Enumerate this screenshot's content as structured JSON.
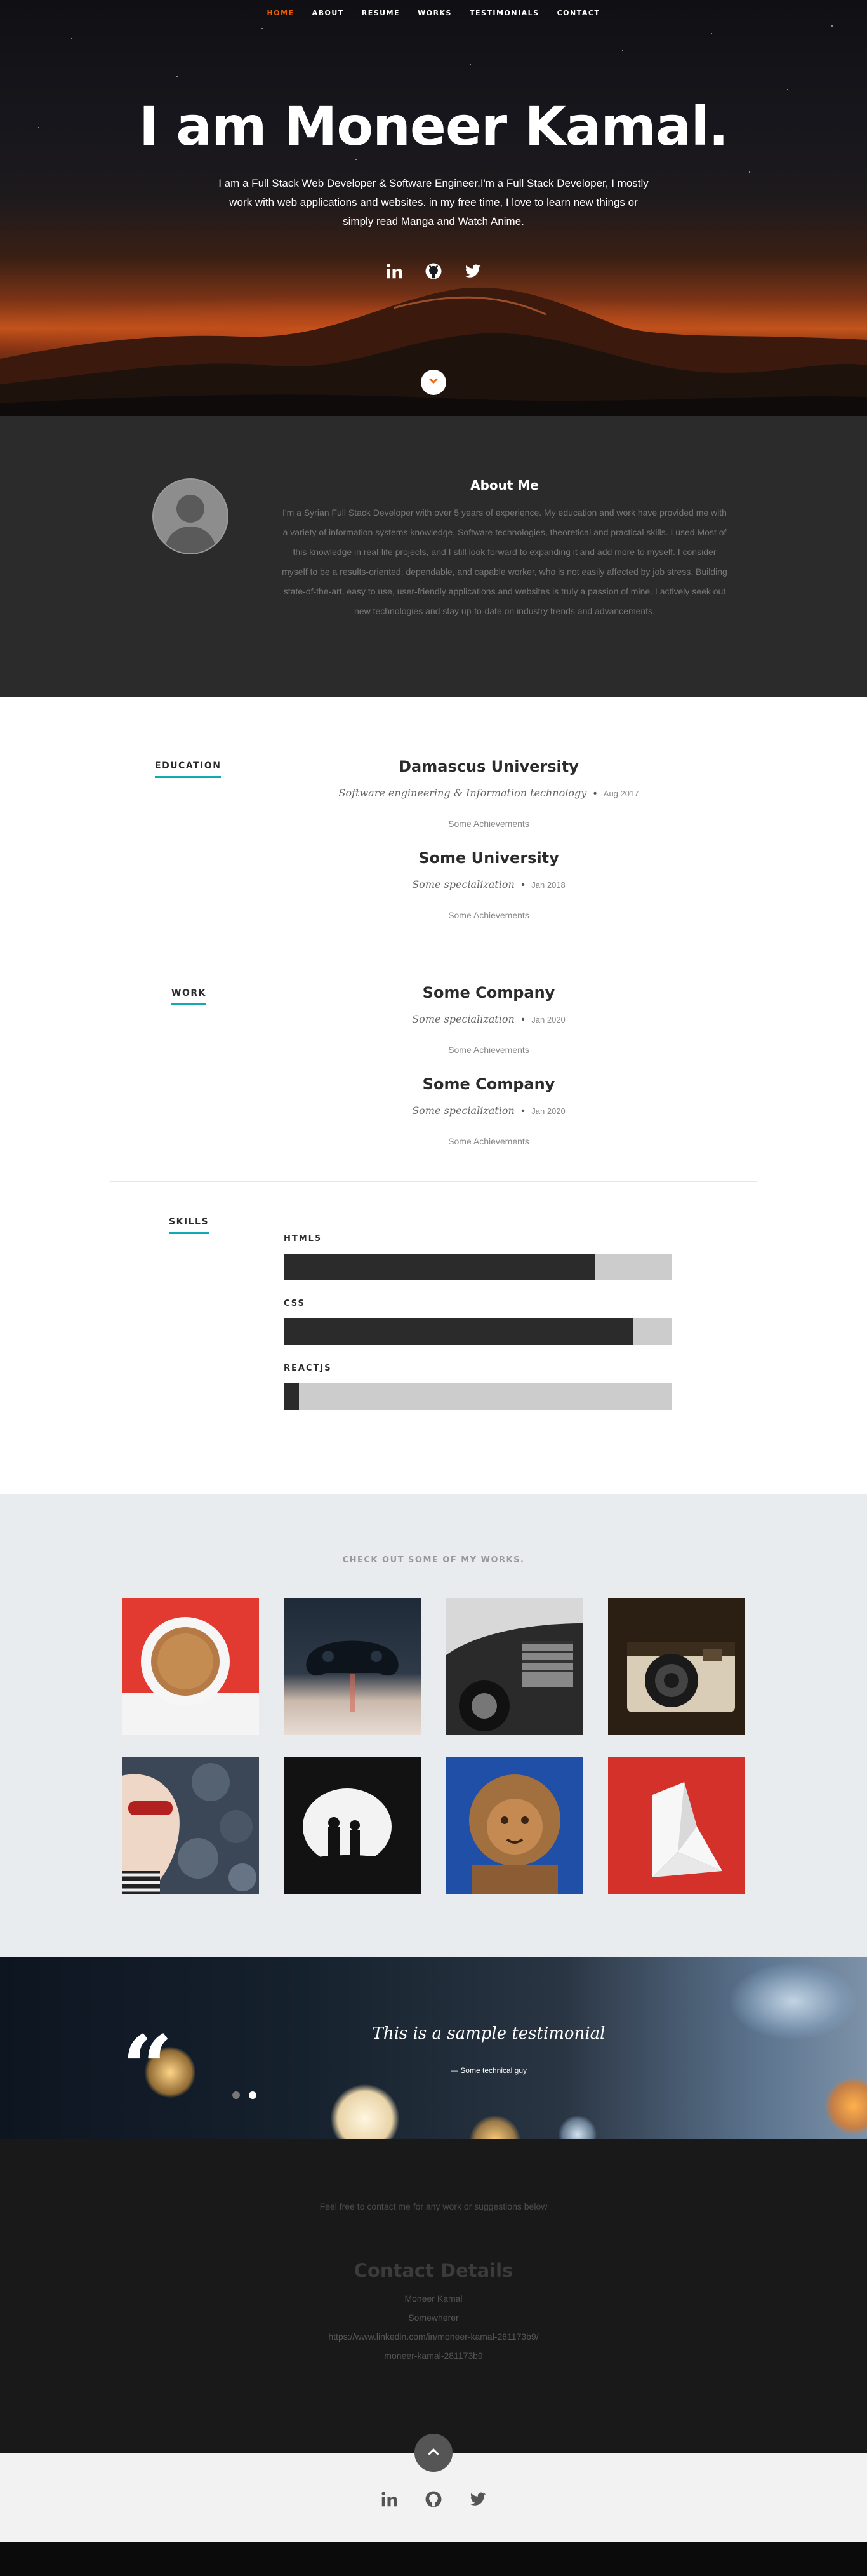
{
  "nav": {
    "items": [
      "HOME",
      "ABOUT",
      "RESUME",
      "WORKS",
      "TESTIMONIALS",
      "CONTACT"
    ],
    "active_index": 0,
    "active_color": "#f06000"
  },
  "hero": {
    "title": "I am Moneer Kamal.",
    "description": "I am a Full Stack Web Developer & Software Engineer.I'm a Full Stack Developer, I mostly work with web applications and websites. in my free time, I love to learn new things or simply read Manga and Watch Anime.",
    "social_icons": [
      "linkedin-icon",
      "github-icon",
      "twitter-icon"
    ]
  },
  "about": {
    "title": "About Me",
    "text": "I'm a Syrian Full Stack Developer with over 5 years of experience. My education and work have provided me with a variety of information systems knowledge, Software technologies, theoretical and practical skills. I used Most of this knowledge in real-life projects, and I still look forward to expanding it and add more to myself. I consider myself to be a results-oriented, dependable, and capable worker, who is not easily affected by job stress. Building state-of-the-art, easy to use, user-friendly applications and websites is truly a passion of mine. I actively seek out new technologies and stay up-to-date on industry trends and advancements."
  },
  "resume": {
    "education_label": "EDUCATION",
    "education": [
      {
        "title": "Damascus University",
        "spec": "Software engineering & Information technology",
        "date": "Aug 2017",
        "achievements": "Some Achievements"
      },
      {
        "title": "Some University",
        "spec": "Some specialization",
        "date": "Jan 2018",
        "achievements": "Some Achievements"
      }
    ],
    "work_label": "WORK",
    "work": [
      {
        "title": "Some Company",
        "spec": "Some specialization",
        "date": "Jan 2020",
        "achievements": "Some Achievements"
      },
      {
        "title": "Some Company",
        "spec": "Some specialization",
        "date": "Jan 2020",
        "achievements": "Some Achievements"
      }
    ],
    "skills_label": "SKILLS",
    "skills": [
      {
        "name": "HTML5",
        "level": 0.8
      },
      {
        "name": "CSS",
        "level": 0.9
      },
      {
        "name": "REACTJS",
        "level": 0.04
      }
    ],
    "accent_color": "#11aab4"
  },
  "portfolio": {
    "title": "CHECK OUT SOME OF MY WORKS.",
    "items": [
      "coffee-cup-image",
      "game-controller-image",
      "vintage-car-image",
      "camera-image",
      "woman-sunglasses-image",
      "cave-silhouette-image",
      "lion-statue-image",
      "origami-image"
    ]
  },
  "testimonial": {
    "quote": "This is a sample testimonial",
    "author": "— Some technical guy",
    "slides": 2,
    "active_slide": 1
  },
  "contact": {
    "intro": "Feel free to contact me for any work or suggestions below",
    "title": "Contact Details",
    "name": "Moneer Kamal",
    "location": "Somewherer",
    "linkedin": "https://www.linkedin.com/in/moneer-kamal-281173b9/",
    "handle": "moneer-kamal-281173b9"
  },
  "footer": {
    "social_icons": [
      "linkedin-icon",
      "github-icon",
      "twitter-icon"
    ]
  }
}
